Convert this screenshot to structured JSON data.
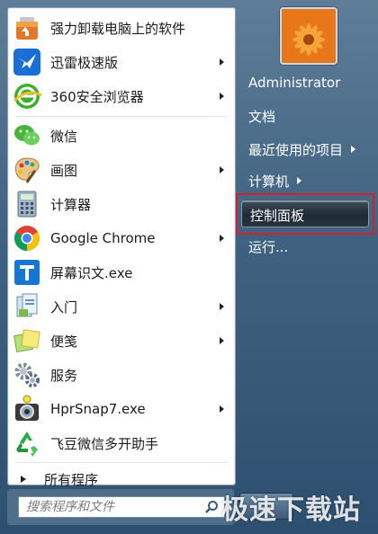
{
  "left_items": [
    {
      "label": "强力卸载电脑上的软件",
      "icon": "uninstaller-box-icon",
      "has_submenu": false
    },
    {
      "label": "迅雷极速版",
      "icon": "thunder-bird-icon",
      "has_submenu": true
    },
    {
      "label": "360安全浏览器",
      "icon": "browser-360-icon",
      "has_submenu": true
    },
    {
      "label": "微信",
      "icon": "wechat-icon",
      "has_submenu": false
    },
    {
      "label": "画图",
      "icon": "paint-palette-icon",
      "has_submenu": true
    },
    {
      "label": "计算器",
      "icon": "calculator-icon",
      "has_submenu": false
    },
    {
      "label": "Google Chrome",
      "icon": "chrome-icon",
      "has_submenu": true
    },
    {
      "label": "屏幕识文.exe",
      "icon": "text-recognition-icon",
      "has_submenu": false
    },
    {
      "label": "入门",
      "icon": "getting-started-icon",
      "has_submenu": true
    },
    {
      "label": "便笺",
      "icon": "sticky-notes-icon",
      "has_submenu": true
    },
    {
      "label": "服务",
      "icon": "services-gear-icon",
      "has_submenu": false
    },
    {
      "label": "HprSnap7.exe",
      "icon": "hypersnap-camera-icon",
      "has_submenu": true
    },
    {
      "label": "飞豆微信多开助手",
      "icon": "recycle-arrows-icon",
      "has_submenu": false
    }
  ],
  "all_programs": "所有程序",
  "search": {
    "placeholder": "搜索程序和文件"
  },
  "right_items": {
    "user": "Administrator",
    "documents": "文档",
    "recent": "最近使用的项目",
    "computer": "计算机",
    "control_panel": "控制面板",
    "run": "运行..."
  },
  "watermark": "极速下载站",
  "colors": {
    "highlight_border": "#d0202a",
    "accent": "#3f6280"
  }
}
